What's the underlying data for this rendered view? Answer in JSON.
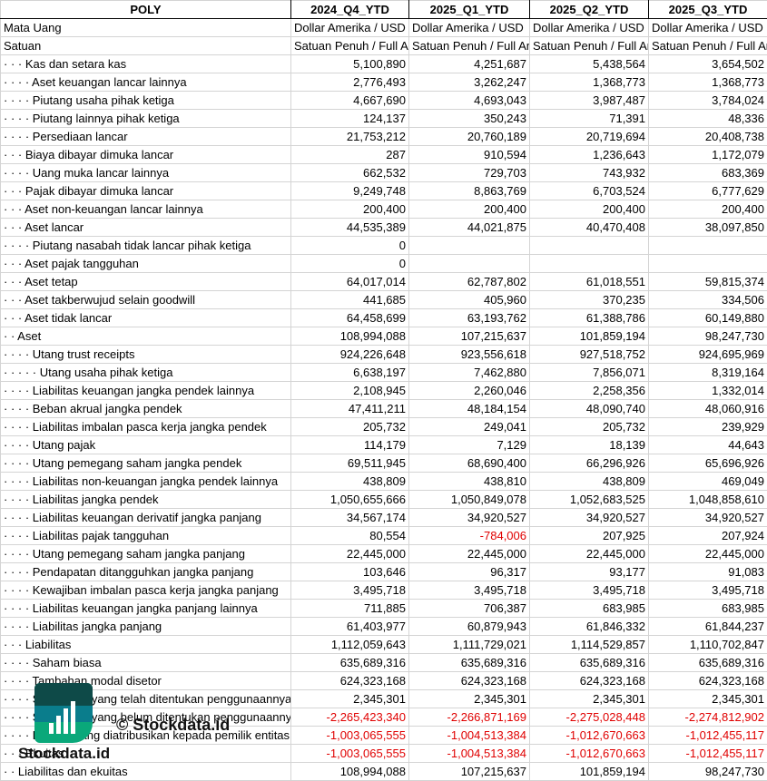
{
  "header": {
    "title": "POLY",
    "periods": [
      "2024_Q4_YTD",
      "2025_Q1_YTD",
      "2025_Q2_YTD",
      "2025_Q3_YTD"
    ]
  },
  "meta": [
    {
      "label": "Mata Uang",
      "values": [
        "Dollar Amerika / USD",
        "Dollar Amerika / USD",
        "Dollar Amerika / USD",
        "Dollar Amerika / USD"
      ]
    },
    {
      "label": "Satuan",
      "values": [
        "Satuan Penuh / Full Amount",
        "Satuan Penuh / Full Amount",
        "Satuan Penuh / Full Amount",
        "Satuan Penuh / Full Amount"
      ]
    }
  ],
  "rows": [
    {
      "label": "· · · Kas dan setara kas",
      "values": [
        "5,100,890",
        "4,251,687",
        "5,438,564",
        "3,654,502"
      ]
    },
    {
      "label": "· · · · Aset keuangan lancar lainnya",
      "values": [
        "2,776,493",
        "3,262,247",
        "1,368,773",
        "1,368,773"
      ]
    },
    {
      "label": "· · · · Piutang usaha pihak ketiga",
      "values": [
        "4,667,690",
        "4,693,043",
        "3,987,487",
        "3,784,024"
      ]
    },
    {
      "label": "· · · · Piutang lainnya pihak ketiga",
      "values": [
        "124,137",
        "350,243",
        "71,391",
        "48,336"
      ]
    },
    {
      "label": "· · · · Persediaan lancar",
      "values": [
        "21,753,212",
        "20,760,189",
        "20,719,694",
        "20,408,738"
      ]
    },
    {
      "label": "· · · Biaya dibayar dimuka lancar",
      "values": [
        "287",
        "910,594",
        "1,236,643",
        "1,172,079"
      ]
    },
    {
      "label": "· · · · Uang muka lancar lainnya",
      "values": [
        "662,532",
        "729,703",
        "743,932",
        "683,369"
      ]
    },
    {
      "label": "· · · Pajak dibayar dimuka lancar",
      "values": [
        "9,249,748",
        "8,863,769",
        "6,703,524",
        "6,777,629"
      ]
    },
    {
      "label": "· · · Aset non-keuangan lancar lainnya",
      "values": [
        "200,400",
        "200,400",
        "200,400",
        "200,400"
      ]
    },
    {
      "label": "· · · Aset lancar",
      "values": [
        "44,535,389",
        "44,021,875",
        "40,470,408",
        "38,097,850"
      ]
    },
    {
      "label": "· · · · Piutang nasabah tidak lancar pihak ketiga",
      "values": [
        "0",
        "",
        "",
        ""
      ]
    },
    {
      "label": "· · · Aset pajak tangguhan",
      "values": [
        "0",
        "",
        "",
        ""
      ]
    },
    {
      "label": "· · · Aset tetap",
      "values": [
        "64,017,014",
        "62,787,802",
        "61,018,551",
        "59,815,374"
      ]
    },
    {
      "label": "· · · Aset takberwujud selain goodwill",
      "values": [
        "441,685",
        "405,960",
        "370,235",
        "334,506"
      ]
    },
    {
      "label": "· · · Aset tidak lancar",
      "values": [
        "64,458,699",
        "63,193,762",
        "61,388,786",
        "60,149,880"
      ]
    },
    {
      "label": "· · Aset",
      "values": [
        "108,994,088",
        "107,215,637",
        "101,859,194",
        "98,247,730"
      ]
    },
    {
      "label": "· · · · Utang trust receipts",
      "values": [
        "924,226,648",
        "923,556,618",
        "927,518,752",
        "924,695,969"
      ]
    },
    {
      "label": "· · · · · Utang usaha pihak ketiga",
      "values": [
        "6,638,197",
        "7,462,880",
        "7,856,071",
        "8,319,164"
      ]
    },
    {
      "label": "· · · · Liabilitas keuangan jangka pendek lainnya",
      "values": [
        "2,108,945",
        "2,260,046",
        "2,258,356",
        "1,332,014"
      ]
    },
    {
      "label": "· · · · Beban akrual jangka pendek",
      "values": [
        "47,411,211",
        "48,184,154",
        "48,090,740",
        "48,060,916"
      ]
    },
    {
      "label": "· · · · Liabilitas imbalan pasca kerja jangka pendek",
      "values": [
        "205,732",
        "249,041",
        "205,732",
        "239,929"
      ]
    },
    {
      "label": "· · · · Utang pajak",
      "values": [
        "114,179",
        "7,129",
        "18,139",
        "44,643"
      ]
    },
    {
      "label": "· · · · Utang pemegang saham jangka pendek",
      "values": [
        "69,511,945",
        "68,690,400",
        "66,296,926",
        "65,696,926"
      ]
    },
    {
      "label": "· · · · Liabilitas non-keuangan jangka pendek lainnya",
      "values": [
        "438,809",
        "438,810",
        "438,809",
        "469,049"
      ]
    },
    {
      "label": "· · · · Liabilitas jangka pendek",
      "values": [
        "1,050,655,666",
        "1,050,849,078",
        "1,052,683,525",
        "1,048,858,610"
      ]
    },
    {
      "label": "· · · · Liabilitas keuangan derivatif jangka panjang",
      "values": [
        "34,567,174",
        "34,920,527",
        "34,920,527",
        "34,920,527"
      ]
    },
    {
      "label": "· · · · Liabilitas pajak tangguhan",
      "values": [
        "80,554",
        "-784,006",
        "207,925",
        "207,924"
      ]
    },
    {
      "label": "· · · · Utang pemegang saham jangka panjang",
      "values": [
        "22,445,000",
        "22,445,000",
        "22,445,000",
        "22,445,000"
      ]
    },
    {
      "label": "· · · · Pendapatan ditangguhkan jangka panjang",
      "values": [
        "103,646",
        "96,317",
        "93,177",
        "91,083"
      ]
    },
    {
      "label": "· · · · Kewajiban imbalan pasca kerja jangka panjang",
      "values": [
        "3,495,718",
        "3,495,718",
        "3,495,718",
        "3,495,718"
      ]
    },
    {
      "label": "· · · · Liabilitas keuangan jangka panjang lainnya",
      "values": [
        "711,885",
        "706,387",
        "683,985",
        "683,985"
      ]
    },
    {
      "label": "· · · · Liabilitas jangka panjang",
      "values": [
        "61,403,977",
        "60,879,943",
        "61,846,332",
        "61,844,237"
      ]
    },
    {
      "label": "· · · Liabilitas",
      "values": [
        "1,112,059,643",
        "1,111,729,021",
        "1,114,529,857",
        "1,110,702,847"
      ]
    },
    {
      "label": "· · · · Saham biasa",
      "values": [
        "635,689,316",
        "635,689,316",
        "635,689,316",
        "635,689,316"
      ]
    },
    {
      "label": "· · · · Tambahan modal disetor",
      "values": [
        "624,323,168",
        "624,323,168",
        "624,323,168",
        "624,323,168"
      ]
    },
    {
      "label": "· · · · Saldo laba yang telah ditentukan penggunaannya",
      "values": [
        "2,345,301",
        "2,345,301",
        "2,345,301",
        "2,345,301"
      ]
    },
    {
      "label": "· · · · Saldo laba yang belum ditentukan penggunaannya",
      "values": [
        "-2,265,423,340",
        "-2,266,871,169",
        "-2,275,028,448",
        "-2,274,812,902"
      ]
    },
    {
      "label": "· · · · Ekuitas yang diatribusikan kepada pemilik entitas induk",
      "values": [
        "-1,003,065,555",
        "-1,004,513,384",
        "-1,012,670,663",
        "-1,012,455,117"
      ]
    },
    {
      "label": "· · · Ekuitas",
      "values": [
        "-1,003,065,555",
        "-1,004,513,384",
        "-1,012,670,663",
        "-1,012,455,117"
      ]
    },
    {
      "label": "· · Liabilitas dan ekuitas",
      "values": [
        "108,994,088",
        "107,215,637",
        "101,859,194",
        "98,247,730"
      ]
    }
  ],
  "watermark": {
    "text": "© Stockdata.id",
    "logo_text": "Stockdata.id"
  },
  "colors": {
    "negative": "#e00000",
    "grid": "#d4d4d4"
  }
}
